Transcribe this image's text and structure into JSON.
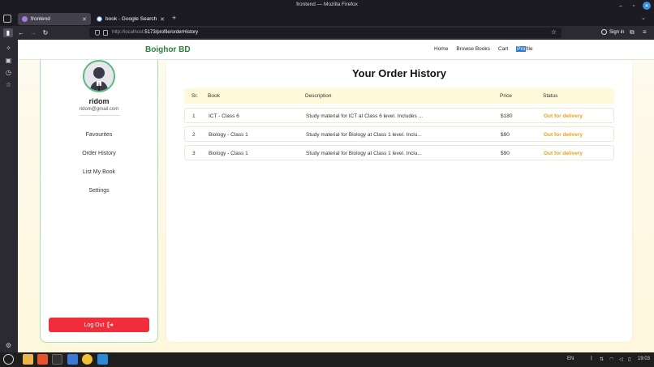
{
  "window": {
    "title": "frontend — Mozilla Firefox"
  },
  "tabs": [
    {
      "label": "frontend",
      "active": true
    },
    {
      "label": "book - Google Search",
      "active": false
    }
  ],
  "url": {
    "host": "http://localhost",
    "path": ":5173/profile/orderHistory"
  },
  "browser": {
    "signin_label": "Sign in"
  },
  "app": {
    "brand": "Boighor BD",
    "nav": [
      "Home",
      "Browse Books",
      "Cart",
      "Profile"
    ]
  },
  "profile": {
    "name": "ridom",
    "email": "ridom@gmail.com",
    "menu": [
      "Favourites",
      "Order History",
      "List My Book",
      "Settings"
    ],
    "logout_label": "Log Out"
  },
  "orders": {
    "title": "Your Order History",
    "columns": [
      "Sr.",
      "Book",
      "Description",
      "Price",
      "Status"
    ],
    "rows": [
      {
        "sr": "1",
        "book": "ICT - Class 6",
        "description": "Study material for ICT at Class 6 level. Includes ...",
        "price": "$180",
        "status": "Out for delivery"
      },
      {
        "sr": "2",
        "book": "Biology - Class 1",
        "description": "Study material for Biology at Class 1 level. Inclu...",
        "price": "$90",
        "status": "Out for delivery"
      },
      {
        "sr": "3",
        "book": "Biology - Class 1",
        "description": "Study material for Biology at Class 1 level. Inclu...",
        "price": "$90",
        "status": "Out for delivery"
      }
    ]
  },
  "taskbar": {
    "lang": "EN",
    "time": "19:03"
  },
  "colors": {
    "brand": "#2e7d3e",
    "logout": "#ef2d3b",
    "status": "#e8a21a",
    "header_row": "#fff8d9"
  }
}
